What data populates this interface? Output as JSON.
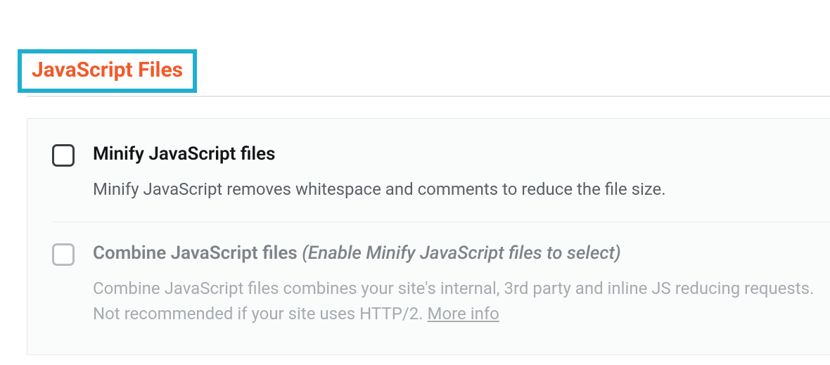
{
  "section": {
    "title": "JavaScript Files"
  },
  "options": [
    {
      "title": "Minify JavaScript files",
      "hint": "",
      "description": "Minify JavaScript removes whitespace and comments to reduce the file size.",
      "enabled": true,
      "more_info": ""
    },
    {
      "title": "Combine JavaScript files",
      "hint": "(Enable Minify JavaScript files to select)",
      "description": "Combine JavaScript files combines your site's internal, 3rd party and inline JS reducing requests. Not recommended if your site uses HTTP/2.",
      "enabled": false,
      "more_info": "More info"
    }
  ]
}
